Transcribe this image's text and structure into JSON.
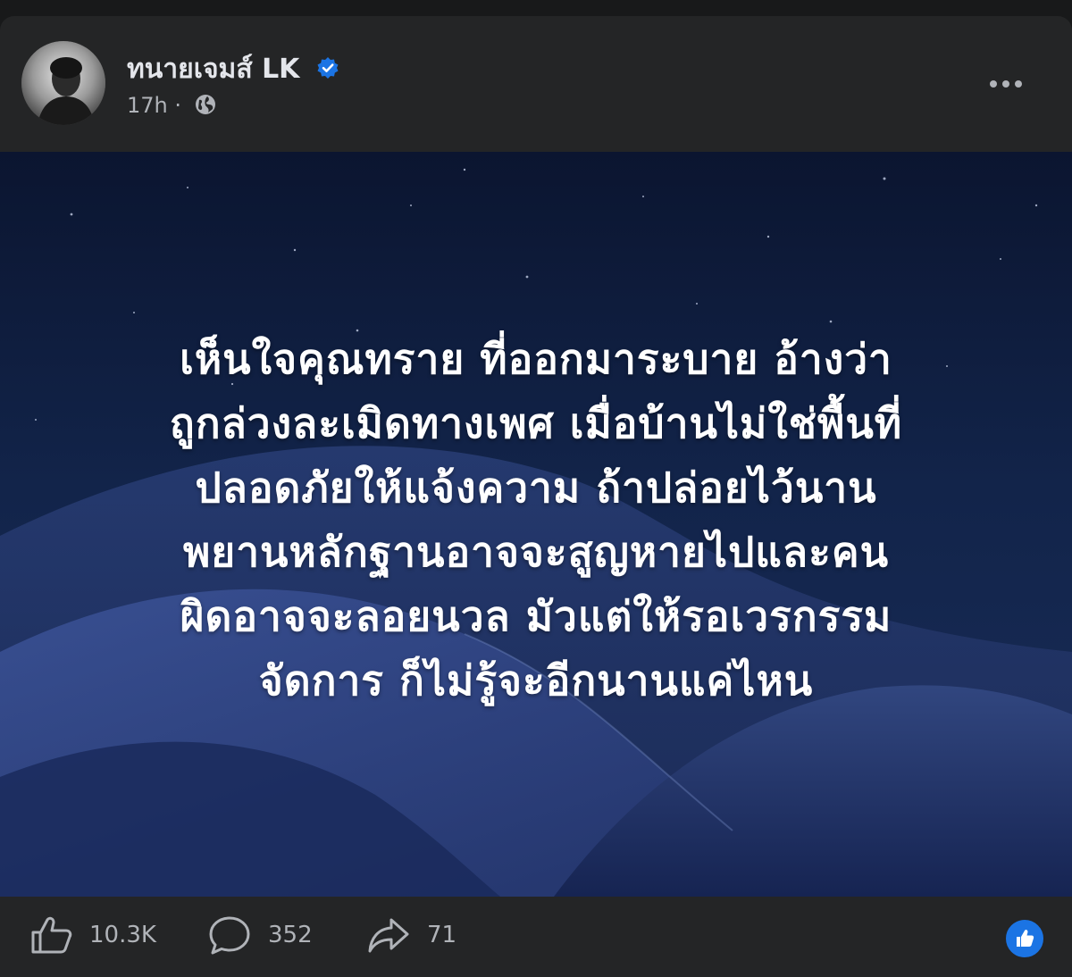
{
  "post": {
    "author": "ทนายเจมส์ LK",
    "verified": true,
    "time": "17h",
    "separator": "·",
    "audience_icon": "globe-icon",
    "more_icon": "more-options-icon"
  },
  "image_text": {
    "lines": [
      "เห็นใจคุณทราย ที่ออกมาระบาย อ้างว่า",
      "ถูกล่วงละเมิดทางเพศ เมื่อบ้านไม่ใช่พื้นที่",
      "ปลอดภัยให้แจ้งความ ถ้าปล่อยไว้นาน",
      "พยานหลักฐานอาจจะสูญหายไปและคน",
      "ผิดอาจจะลอยนวล มัวแต่ให้รอเวรกรรม",
      "จัดการ ก็ไม่รู้จะอีกนานแค่ไหน"
    ]
  },
  "actions": {
    "likes": "10.3K",
    "comments": "352",
    "shares": "71",
    "like_icon": "thumbs-up-icon",
    "comment_icon": "comment-bubble-icon",
    "share_icon": "share-arrow-icon",
    "reaction_icon": "like-reaction-icon"
  },
  "colors": {
    "background": "#18191a",
    "card": "#242526",
    "text_primary": "#e4e6eb",
    "text_secondary": "#b0b3b8",
    "verified_blue": "#1b74e4",
    "image_sky": "#0d1b3a"
  }
}
